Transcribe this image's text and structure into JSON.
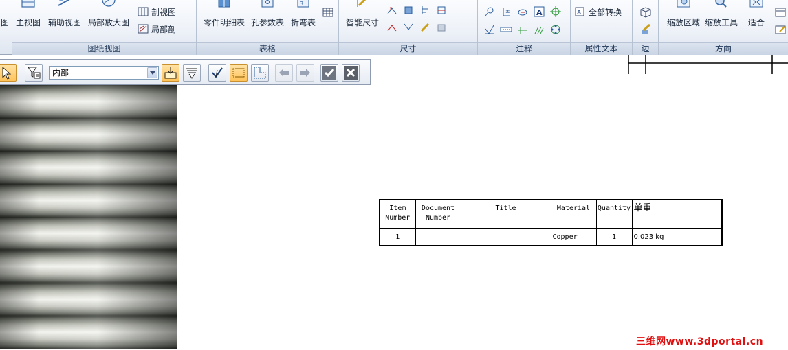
{
  "ribbon": {
    "groups": [
      {
        "caption": "图纸视图",
        "big_buttons": [
          "主视图",
          "辅助视图",
          "局部放大图"
        ],
        "small_buttons": [
          "剖视图",
          "局部剖"
        ]
      },
      {
        "caption": "表格",
        "big_buttons": [
          "零件明细表",
          "孔参数表",
          "折弯表"
        ]
      },
      {
        "caption": "尺寸",
        "big_buttons": [
          "智能尺寸"
        ]
      },
      {
        "caption": "注释"
      },
      {
        "caption": "属性文本",
        "small_buttons": [
          "全部转换"
        ]
      },
      {
        "caption": "边"
      },
      {
        "caption": "方向",
        "big_buttons": [
          "缩放区域",
          "缩放工具",
          "适合"
        ]
      }
    ],
    "partial_left_label": "图"
  },
  "selection_toolbar": {
    "filter_value": "内部",
    "buttons": [
      "select-arrow",
      "filter",
      "highlight-inside",
      "highlight-overlap",
      "check-select",
      "rect-select",
      "polyline-select",
      "back",
      "forward",
      "accept",
      "cancel"
    ]
  },
  "bom_table": {
    "headers": [
      "Item Number",
      "Document Number",
      "Title",
      "Material",
      "Quantity",
      "单重"
    ],
    "header_lines": [
      [
        "Item",
        "Number"
      ],
      [
        "Document",
        "Number"
      ],
      [
        "Title"
      ],
      [
        "Material"
      ],
      [
        "Quantity"
      ],
      [
        "单重"
      ]
    ],
    "rows": [
      [
        "1",
        "",
        "",
        "Copper",
        "1",
        "0.023 kg"
      ]
    ]
  },
  "watermark": "三维网www.3dportal.cn",
  "colors": {
    "accent_orange": "#ffc35a",
    "watermark_red": "#e01010",
    "ribbon_caption": "#243b5a"
  }
}
